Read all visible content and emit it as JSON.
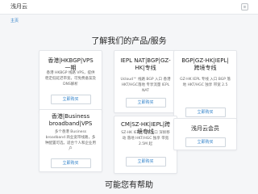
{
  "header": {
    "logo_text": "浅月云",
    "user_icon": "user-icon"
  },
  "breadcrumb": "主页",
  "sections": {
    "products_title": "了解我们的产品/服务",
    "help_title": "可能您有帮助"
  },
  "cards": [
    {
      "title": "香港|HKBGP|VPS 一期",
      "desc": "香港 HKBGP 线路 VPS，提供稳定低延迟带宽，可免费备案及DNS解析",
      "button": "立即购买"
    },
    {
      "title": "IEPL NAT|BGP|GZ-HK|专线",
      "desc": "Ucloud™ 线路 BGP 入口 香港HKT/HGC落地 专享流量 IEPL NAT",
      "button": "立即购买"
    },
    {
      "title": "BGP|GZ-HK|IEPL|跨境专线",
      "desc": "GZ-HK IEPL 专线 入口 BGP 落地 HKT/HGC 独享 带宽 2.5",
      "button": "立即购买"
    },
    {
      "title": "香港|Business broadband|VPS",
      "desc": "多个香港 Business broadband 商业宽带线路，多种配置可选，适合个人和企业用户",
      "button": "立即购买"
    },
    {
      "title": "CM|SZ-HK|IEPL|跨境专线",
      "desc": "SZ-HK IEPL 专线 入口 深圳移动 落地 HKT/HGC 独享 带宽 2.5M 起",
      "button": "立即购买"
    },
    {
      "title": "浅月云会员",
      "desc": "",
      "button": "立即购买"
    }
  ]
}
